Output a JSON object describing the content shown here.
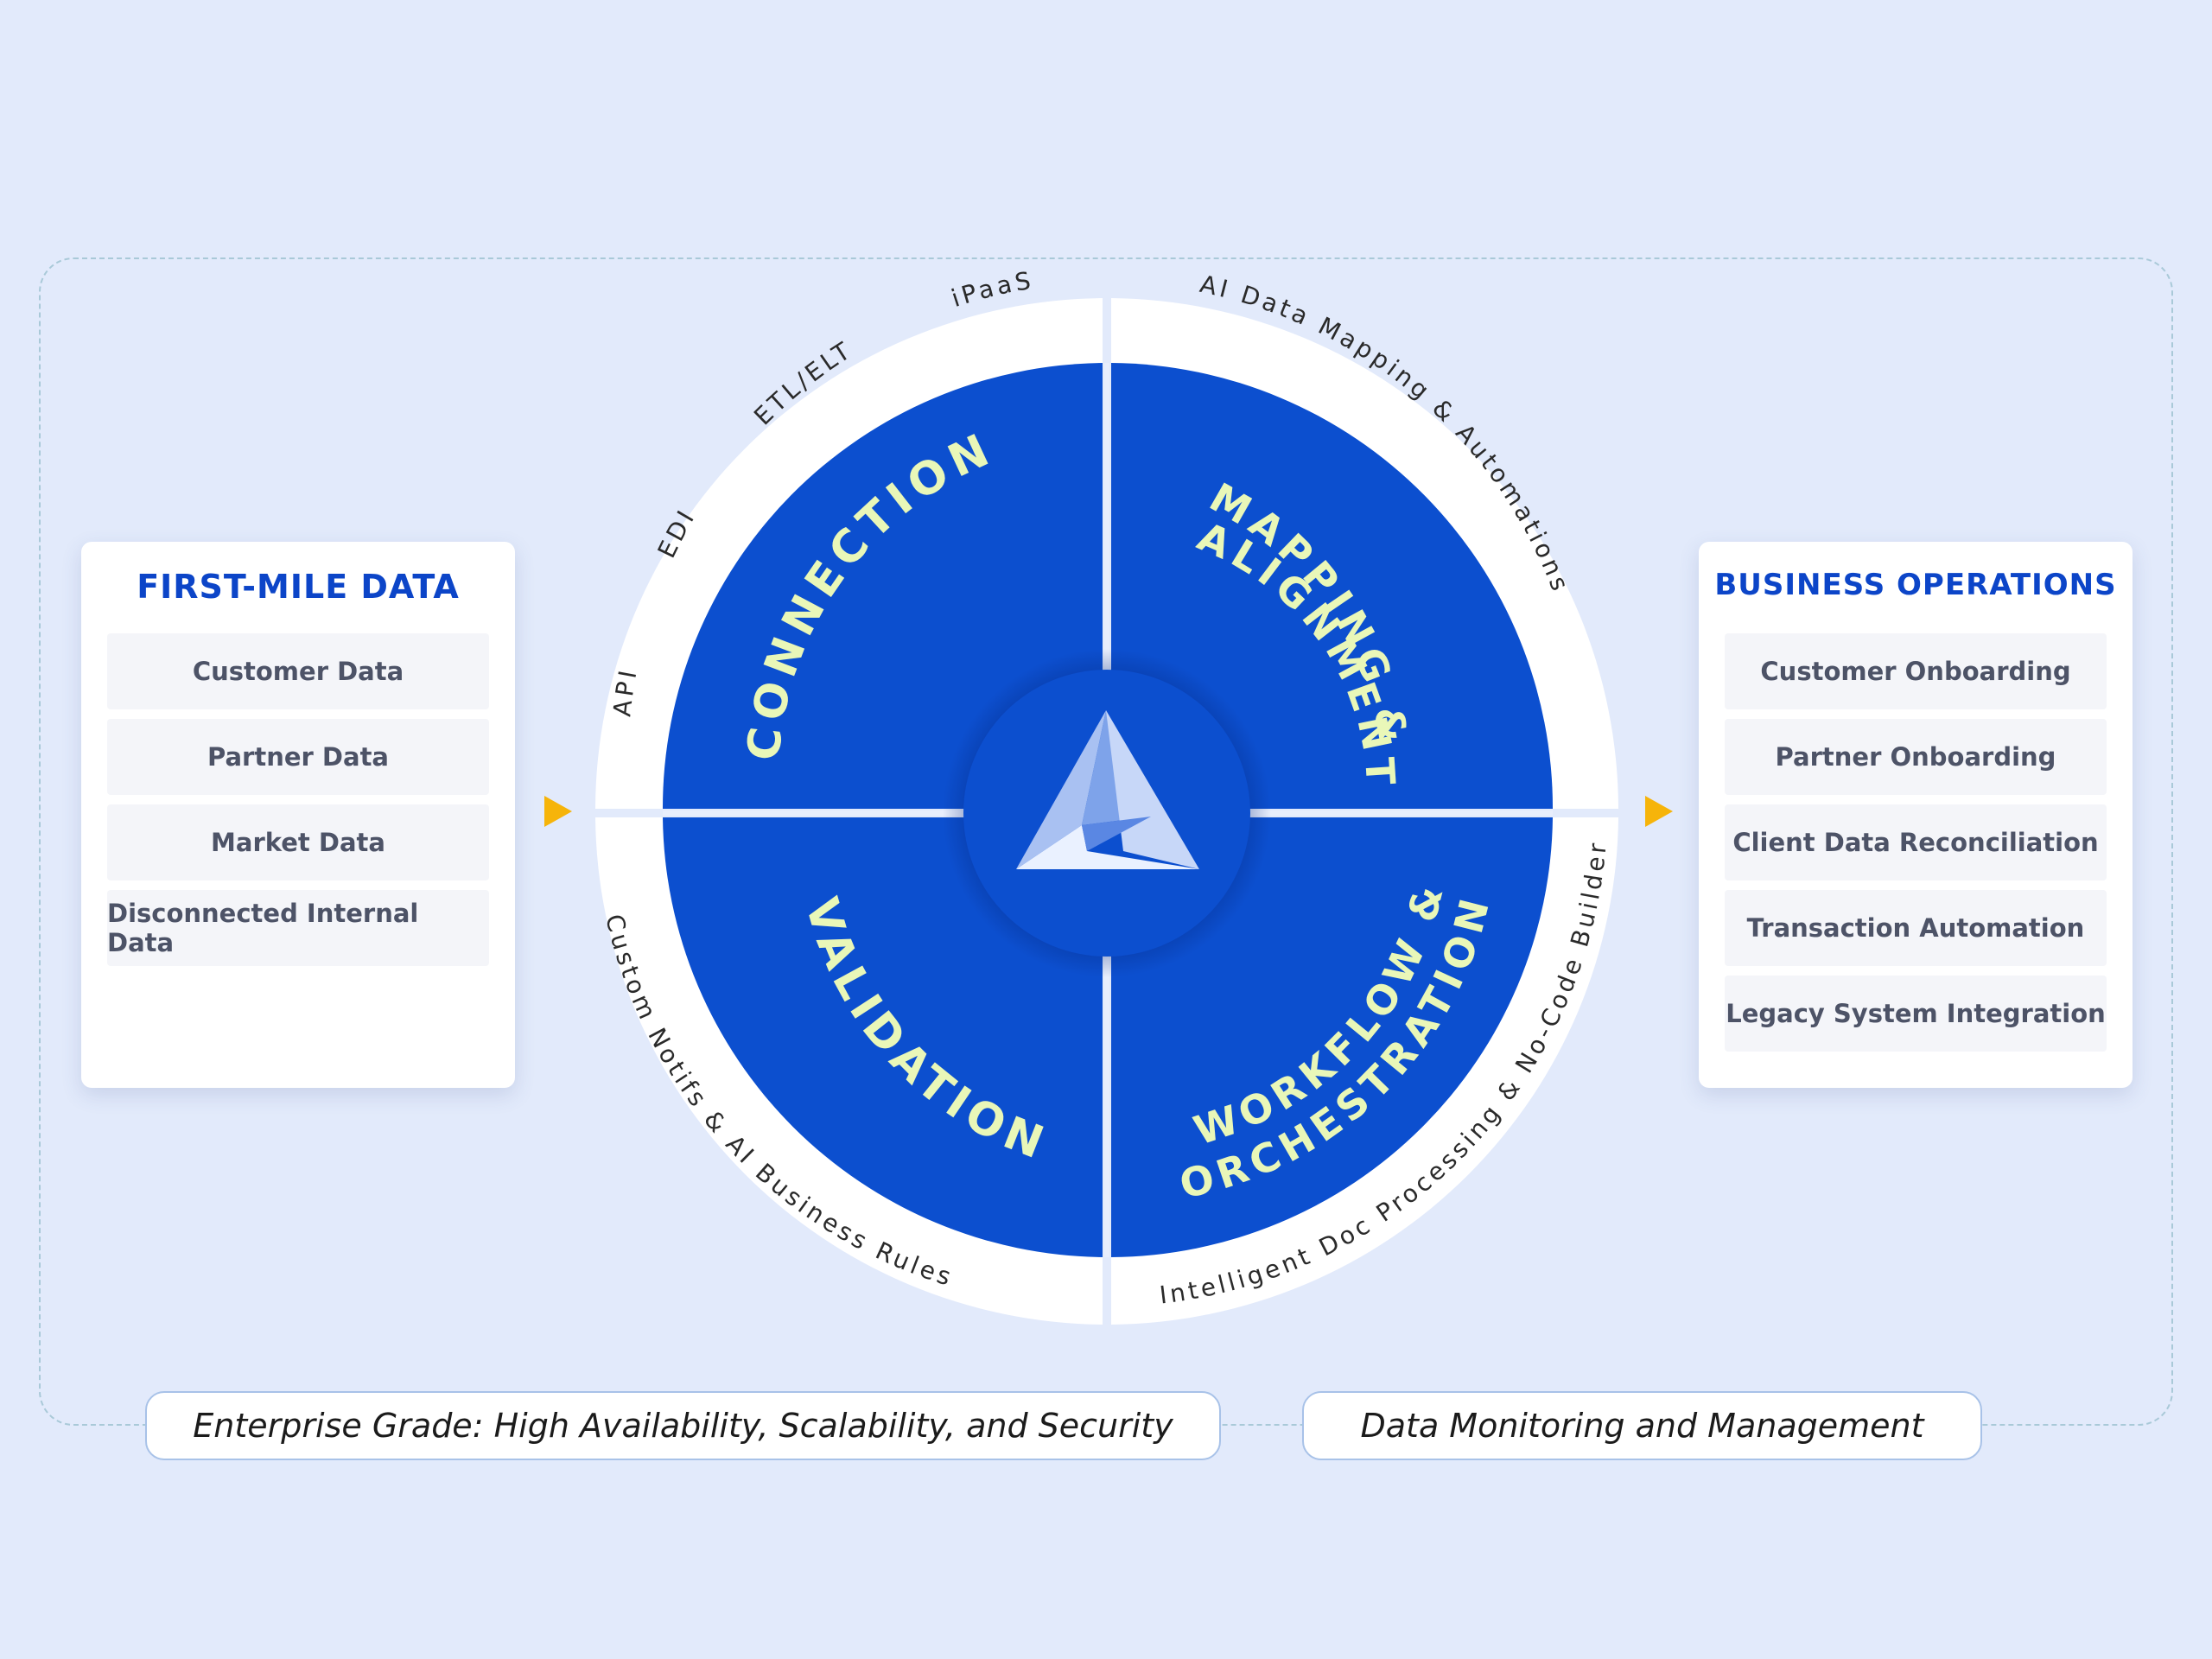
{
  "left_panel": {
    "title": "FIRST-MILE DATA",
    "items": [
      "Customer Data",
      "Partner Data",
      "Market Data",
      "Disconnected Internal Data"
    ]
  },
  "right_panel": {
    "title": "BUSINESS OPERATIONS",
    "items": [
      "Customer Onboarding",
      "Partner Onboarding",
      "Client Data Reconciliation",
      "Transaction Automation",
      "Legacy System Integration"
    ]
  },
  "wheel": {
    "quadrants": {
      "connection": {
        "line1": "CONNECTION",
        "line2": ""
      },
      "mapping": {
        "line1": "MAPPING &",
        "line2": "ALIGNMENT"
      },
      "validation": {
        "line1": "VALIDATION",
        "line2": ""
      },
      "workflow": {
        "line1": "WORKFLOW &",
        "line2": "ORCHESTRATION"
      }
    },
    "outer_labels": {
      "api": "API",
      "edi": "EDI",
      "etl": "ETL/ELT",
      "ipaas": "iPaaS",
      "mapping": "AI Data Mapping & Automations",
      "validation": "Custom Notifs & AI Business Rules",
      "workflow": "Intelligent Doc Processing & No-Code Builder"
    },
    "center_icon": "triangle-logo-icon"
  },
  "footer": {
    "left_pill": "Enterprise Grade: High Availability, Scalability, and Security",
    "right_pill": "Data Monitoring and Management"
  },
  "colors": {
    "background": "#e2eafb",
    "quadrant_blue": "#0c4fcf",
    "quadrant_text": "#e9f7b8",
    "title_blue": "#0c45c8",
    "arrow": "#f6b40a"
  }
}
